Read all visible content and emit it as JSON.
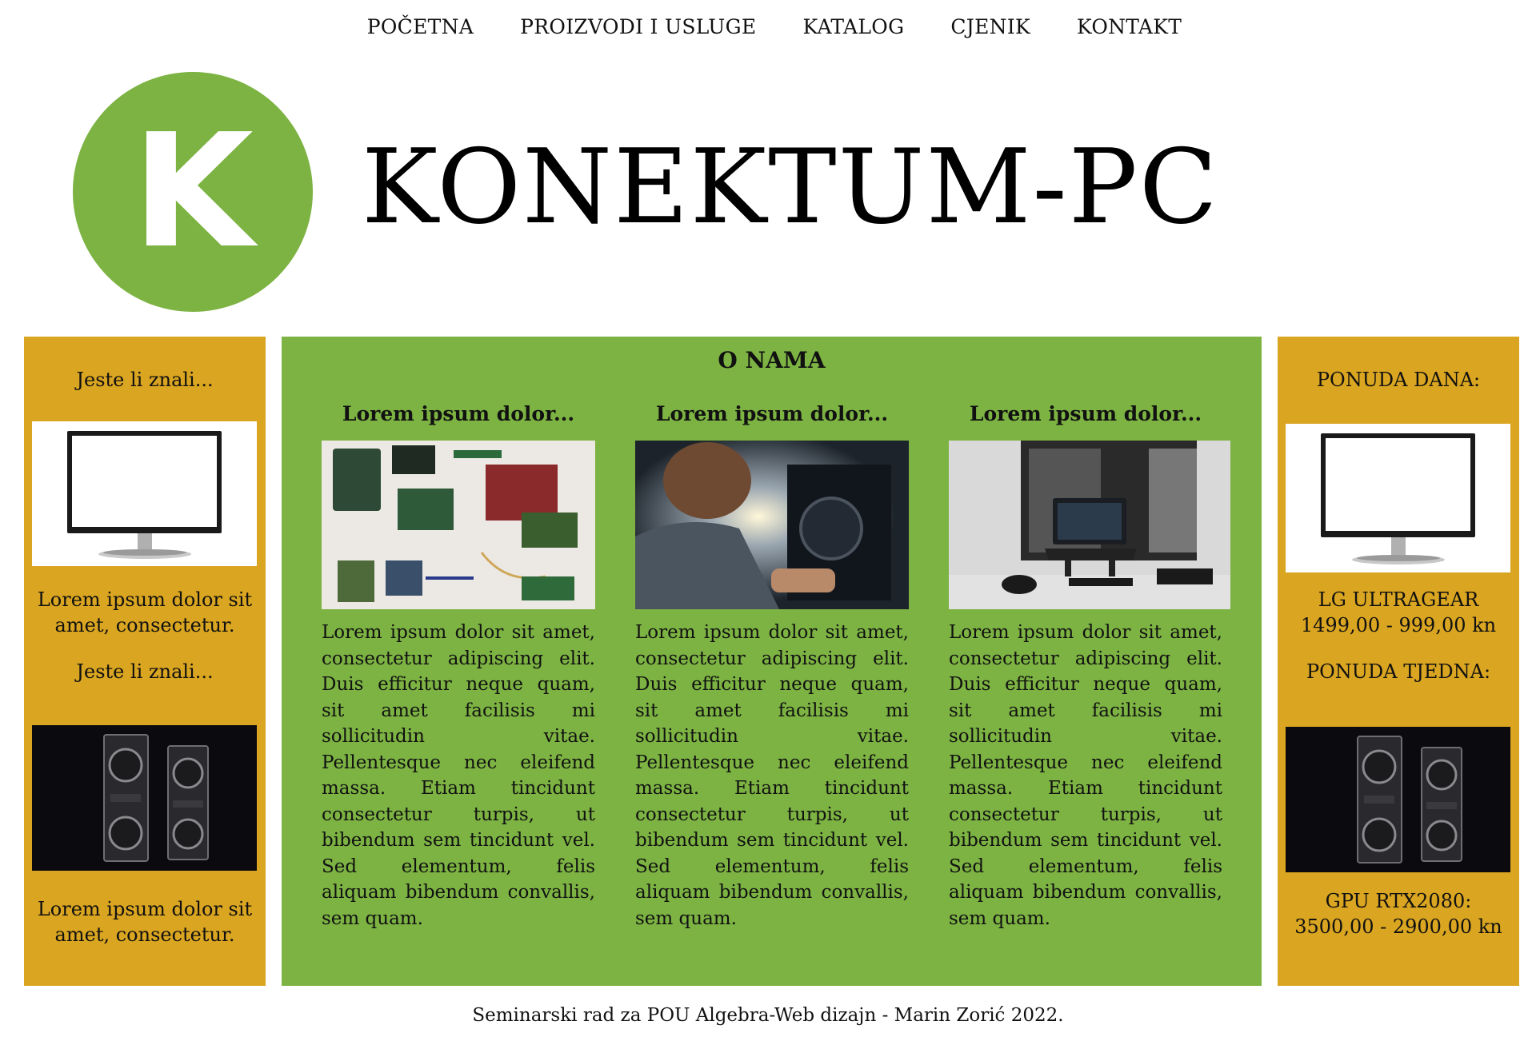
{
  "nav": {
    "items": [
      "POČETNA",
      "PROIZVODI I USLUGE",
      "KATALOG",
      "CJENIK",
      "KONTAKT"
    ]
  },
  "header": {
    "logo_letter": "K",
    "site_title": "KONEKTUM-PC",
    "brand_color": "#7cb342"
  },
  "left_sidebar": {
    "heading_1": "Jeste li znali...",
    "image_1": "monitor-image",
    "text_1": "Lorem ipsum dolor sit amet, consectetur.",
    "heading_2": "Jeste li znali...",
    "image_2": "graphics-cards-image",
    "text_2": "Lorem ipsum dolor sit amet, consectetur.",
    "background_color": "#daa520"
  },
  "main": {
    "title": "O NAMA",
    "columns": [
      {
        "heading": "Lorem ipsum dolor...",
        "image": "computer-parts-photo",
        "text": "Lorem ipsum dolor sit amet, consectetur adipiscing elit. Duis efficitur neque quam, sit amet facilisis mi sollicitudin vitae. Pellentesque nec eleifend massa. Etiam tincidunt consectetur turpis, ut bibendum sem tincidunt vel. Sed elementum, felis aliquam bibendum convallis, sem quam."
      },
      {
        "heading": "Lorem ipsum dolor...",
        "image": "technician-repair-photo",
        "text": "Lorem ipsum dolor sit amet, consectetur adipiscing elit. Duis efficitur neque quam, sit amet facilisis mi sollicitudin vitae. Pellentesque nec eleifend massa. Etiam tincidunt consectetur turpis, ut bibendum sem tincidunt vel. Sed elementum, felis aliquam bibendum convallis, sem quam."
      },
      {
        "heading": "Lorem ipsum dolor...",
        "image": "laptop-desk-photo",
        "text": "Lorem ipsum dolor sit amet, consectetur adipiscing elit. Duis efficitur neque quam, sit amet facilisis mi sollicitudin vitae. Pellentesque nec eleifend massa. Etiam tincidunt consectetur turpis, ut bibendum sem tincidunt vel. Sed elementum, felis aliquam bibendum convallis, sem quam."
      }
    ],
    "background_color": "#7cb342"
  },
  "right_sidebar": {
    "heading_1": "PONUDA DANA:",
    "image_1": "monitor-image",
    "product_1": "LG ULTRAGEAR",
    "price_1": "1499,00 - 999,00 kn",
    "heading_2": "PONUDA TJEDNA:",
    "image_2": "graphics-cards-image",
    "product_2": "GPU RTX2080:",
    "price_2": "3500,00 - 2900,00 kn",
    "price_color": "#ff1a1a"
  },
  "footer": {
    "text": "Seminarski rad za POU Algebra-Web dizajn - Marin Zorić 2022."
  }
}
